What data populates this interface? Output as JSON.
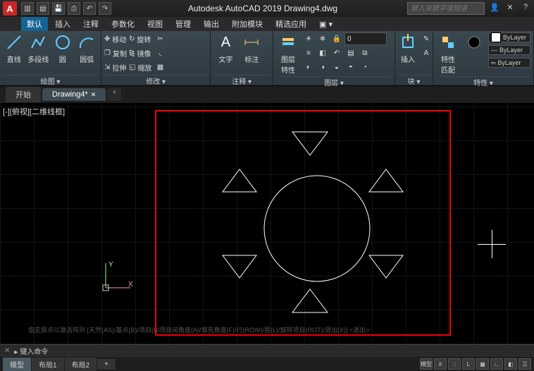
{
  "title": "Autodesk AutoCAD 2019   Drawing4.dwg",
  "search_placeholder": "键入关键字或短语",
  "menus": [
    "默认",
    "插入",
    "注释",
    "参数化",
    "视图",
    "管理",
    "输出",
    "附加模块",
    "精选应用"
  ],
  "ribbon": {
    "draw": {
      "title": "绘图 ▾",
      "line": "直线",
      "polyline": "多段线",
      "circle": "圆",
      "arc": "圆弧"
    },
    "modify": {
      "title": "修改 ▾",
      "move": "移动",
      "rotate": "旋转",
      "copy": "复制",
      "mirror": "镜像",
      "stretch": "拉伸",
      "scale": "缩放"
    },
    "annotate": {
      "title": "注释 ▾",
      "text": "文字",
      "dim": "标注"
    },
    "layers": {
      "title": "图层 ▾",
      "button": "图层\n特性",
      "current": "0"
    },
    "block": {
      "title": "块 ▾",
      "insert": "插入"
    },
    "properties": {
      "title": "特性 ▾",
      "match": "特性\n匹配",
      "bylayer": "ByLayer"
    }
  },
  "doctabs": {
    "start": "开始",
    "active": "Drawing4*"
  },
  "viewport_label": "[-][俯视][二维线框]",
  "ucs": {
    "x": "X",
    "y": "Y"
  },
  "command_history": "指定原点以激活阵列  [天然(AS)/基点(B)/项目(I)/项目间角度(A)/填充角度(F)/行(ROW)/层(L)/旋转项目(ROT)/退出(X)] <退出>:",
  "cmdline_prompt": "▸ 键入命令",
  "layout_tabs": [
    "模型",
    "布局1",
    "布局2"
  ],
  "status_right": [
    "模型",
    "#",
    "::",
    "L",
    "▦",
    "∟",
    "◧",
    "三"
  ]
}
